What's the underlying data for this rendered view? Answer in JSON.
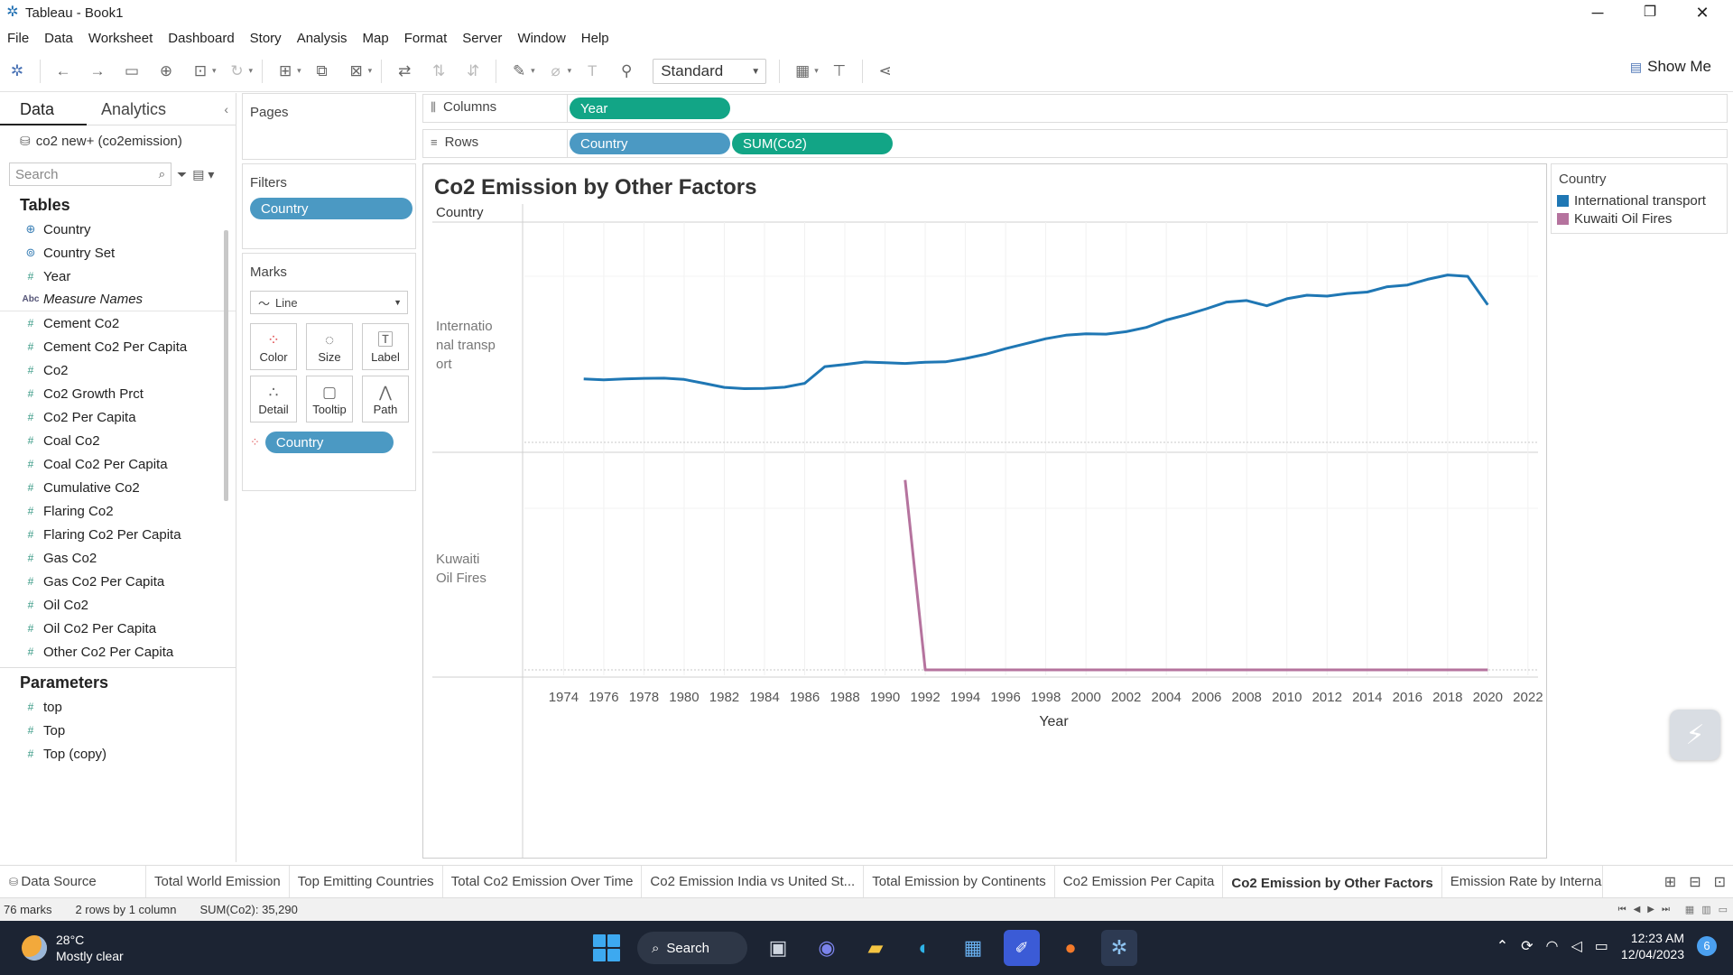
{
  "window": {
    "title": "Tableau - Book1",
    "minimize": "─",
    "restore": "❐",
    "close": "✕"
  },
  "menu": [
    "File",
    "Data",
    "Worksheet",
    "Dashboard",
    "Story",
    "Analysis",
    "Map",
    "Format",
    "Server",
    "Window",
    "Help"
  ],
  "toolbar": {
    "fit_select": "Standard",
    "show_me": "Show Me"
  },
  "data_pane": {
    "tab_data": "Data",
    "tab_analytics": "Analytics",
    "datasource": "co2 new+ (co2emission)",
    "search_placeholder": "Search",
    "tables_heading": "Tables",
    "fields": [
      {
        "name": "Country",
        "type": "geo"
      },
      {
        "name": "Country Set",
        "type": "set"
      },
      {
        "name": "Year",
        "type": "num"
      },
      {
        "name": "Measure Names",
        "type": "abc"
      },
      {
        "name": "Cement Co2",
        "type": "num"
      },
      {
        "name": "Cement Co2 Per Capita",
        "type": "num"
      },
      {
        "name": "Co2",
        "type": "num"
      },
      {
        "name": "Co2 Growth Prct",
        "type": "num"
      },
      {
        "name": "Co2 Per Capita",
        "type": "num"
      },
      {
        "name": "Coal Co2",
        "type": "num"
      },
      {
        "name": "Coal Co2 Per Capita",
        "type": "num"
      },
      {
        "name": "Cumulative Co2",
        "type": "num"
      },
      {
        "name": "Flaring Co2",
        "type": "num"
      },
      {
        "name": "Flaring Co2 Per Capita",
        "type": "num"
      },
      {
        "name": "Gas Co2",
        "type": "num"
      },
      {
        "name": "Gas Co2 Per Capita",
        "type": "num"
      },
      {
        "name": "Oil Co2",
        "type": "num"
      },
      {
        "name": "Oil Co2 Per Capita",
        "type": "num"
      },
      {
        "name": "Other Co2 Per Capita",
        "type": "num"
      }
    ],
    "parameters_heading": "Parameters",
    "parameters": [
      "top",
      "Top",
      "Top (copy)"
    ]
  },
  "shelves": {
    "pages": "Pages",
    "filters": "Filters",
    "filter_pill": "Country",
    "marks": "Marks",
    "mark_type": "Line",
    "mark_buttons": [
      "Color",
      "Size",
      "Label",
      "Detail",
      "Tooltip",
      "Path"
    ],
    "marks_pill": "Country",
    "columns_label": "Columns",
    "columns_pill": "Year",
    "rows_label": "Rows",
    "rows_pills": [
      "Country",
      "SUM(Co2)"
    ]
  },
  "view": {
    "title": "Co2 Emission by Other Factors",
    "row_header": "Country",
    "row_labels": [
      "Internatio nal transp ort",
      "Kuwaiti Oil Fires"
    ]
  },
  "legend": {
    "title": "Country",
    "items": [
      {
        "label": "International transport",
        "color": "#1f77b4"
      },
      {
        "label": "Kuwaiti Oil Fires",
        "color": "#b5739e"
      }
    ]
  },
  "chart_data": {
    "type": "line",
    "xlabel": "Year",
    "x_ticks": [
      1974,
      1976,
      1978,
      1980,
      1982,
      1984,
      1986,
      1988,
      1990,
      1992,
      1994,
      1996,
      1998,
      2000,
      2002,
      2004,
      2006,
      2008,
      2010,
      2012,
      2014,
      2016,
      2018,
      2020,
      2022
    ],
    "xlim": [
      1972.5,
      2022.5
    ],
    "series": [
      {
        "name": "International transport",
        "color": "#1f77b4",
        "panel": 0,
        "ylim": [
          0,
          1250
        ],
        "points": [
          [
            1975,
            360
          ],
          [
            1976,
            355
          ],
          [
            1977,
            360
          ],
          [
            1978,
            363
          ],
          [
            1979,
            364
          ],
          [
            1980,
            357
          ],
          [
            1981,
            335
          ],
          [
            1982,
            312
          ],
          [
            1983,
            305
          ],
          [
            1984,
            306
          ],
          [
            1985,
            313
          ],
          [
            1986,
            335
          ],
          [
            1987,
            430
          ],
          [
            1988,
            442
          ],
          [
            1989,
            456
          ],
          [
            1990,
            452
          ],
          [
            1991,
            448
          ],
          [
            1992,
            455
          ],
          [
            1993,
            457
          ],
          [
            1994,
            476
          ],
          [
            1995,
            500
          ],
          [
            1996,
            532
          ],
          [
            1997,
            560
          ],
          [
            1998,
            588
          ],
          [
            1999,
            608
          ],
          [
            2000,
            616
          ],
          [
            2001,
            614
          ],
          [
            2002,
            628
          ],
          [
            2003,
            652
          ],
          [
            2004,
            694
          ],
          [
            2005,
            724
          ],
          [
            2006,
            758
          ],
          [
            2007,
            796
          ],
          [
            2008,
            805
          ],
          [
            2009,
            775
          ],
          [
            2010,
            815
          ],
          [
            2011,
            835
          ],
          [
            2012,
            830
          ],
          [
            2013,
            845
          ],
          [
            2014,
            853
          ],
          [
            2015,
            883
          ],
          [
            2016,
            893
          ],
          [
            2017,
            925
          ],
          [
            2018,
            950
          ],
          [
            2019,
            942
          ],
          [
            2020,
            780
          ]
        ]
      },
      {
        "name": "Kuwaiti Oil Fires",
        "color": "#b5739e",
        "panel": 1,
        "ylim": [
          0,
          500
        ],
        "points": [
          [
            1991,
            440
          ],
          [
            1992,
            0
          ],
          [
            1994,
            0
          ],
          [
            1996,
            0
          ],
          [
            1998,
            0
          ],
          [
            2000,
            0
          ],
          [
            2002,
            0
          ],
          [
            2004,
            0
          ],
          [
            2006,
            0
          ],
          [
            2008,
            0
          ],
          [
            2010,
            0
          ],
          [
            2012,
            0
          ],
          [
            2014,
            0
          ],
          [
            2016,
            0
          ],
          [
            2018,
            0
          ],
          [
            2020,
            0
          ]
        ]
      }
    ]
  },
  "sheet_tabs": [
    "Data Source",
    "Total World Emission",
    "Top Emitting Countries",
    "Total Co2 Emission Over Time",
    "Co2 Emission India vs United St...",
    "Total Emission by Continents",
    "Co2 Emission Per Capita",
    "Co2 Emission  by Other Factors",
    "Emission Rate by Interna"
  ],
  "active_sheet": 7,
  "status": {
    "marks": "76 marks",
    "dims": "2 rows by 1 column",
    "sum": "SUM(Co2): 35,290"
  },
  "taskbar": {
    "temp": "28°C",
    "weather": "Mostly clear",
    "search": "Search",
    "time": "12:23 AM",
    "date": "12/04/2023",
    "notifications": "6"
  }
}
